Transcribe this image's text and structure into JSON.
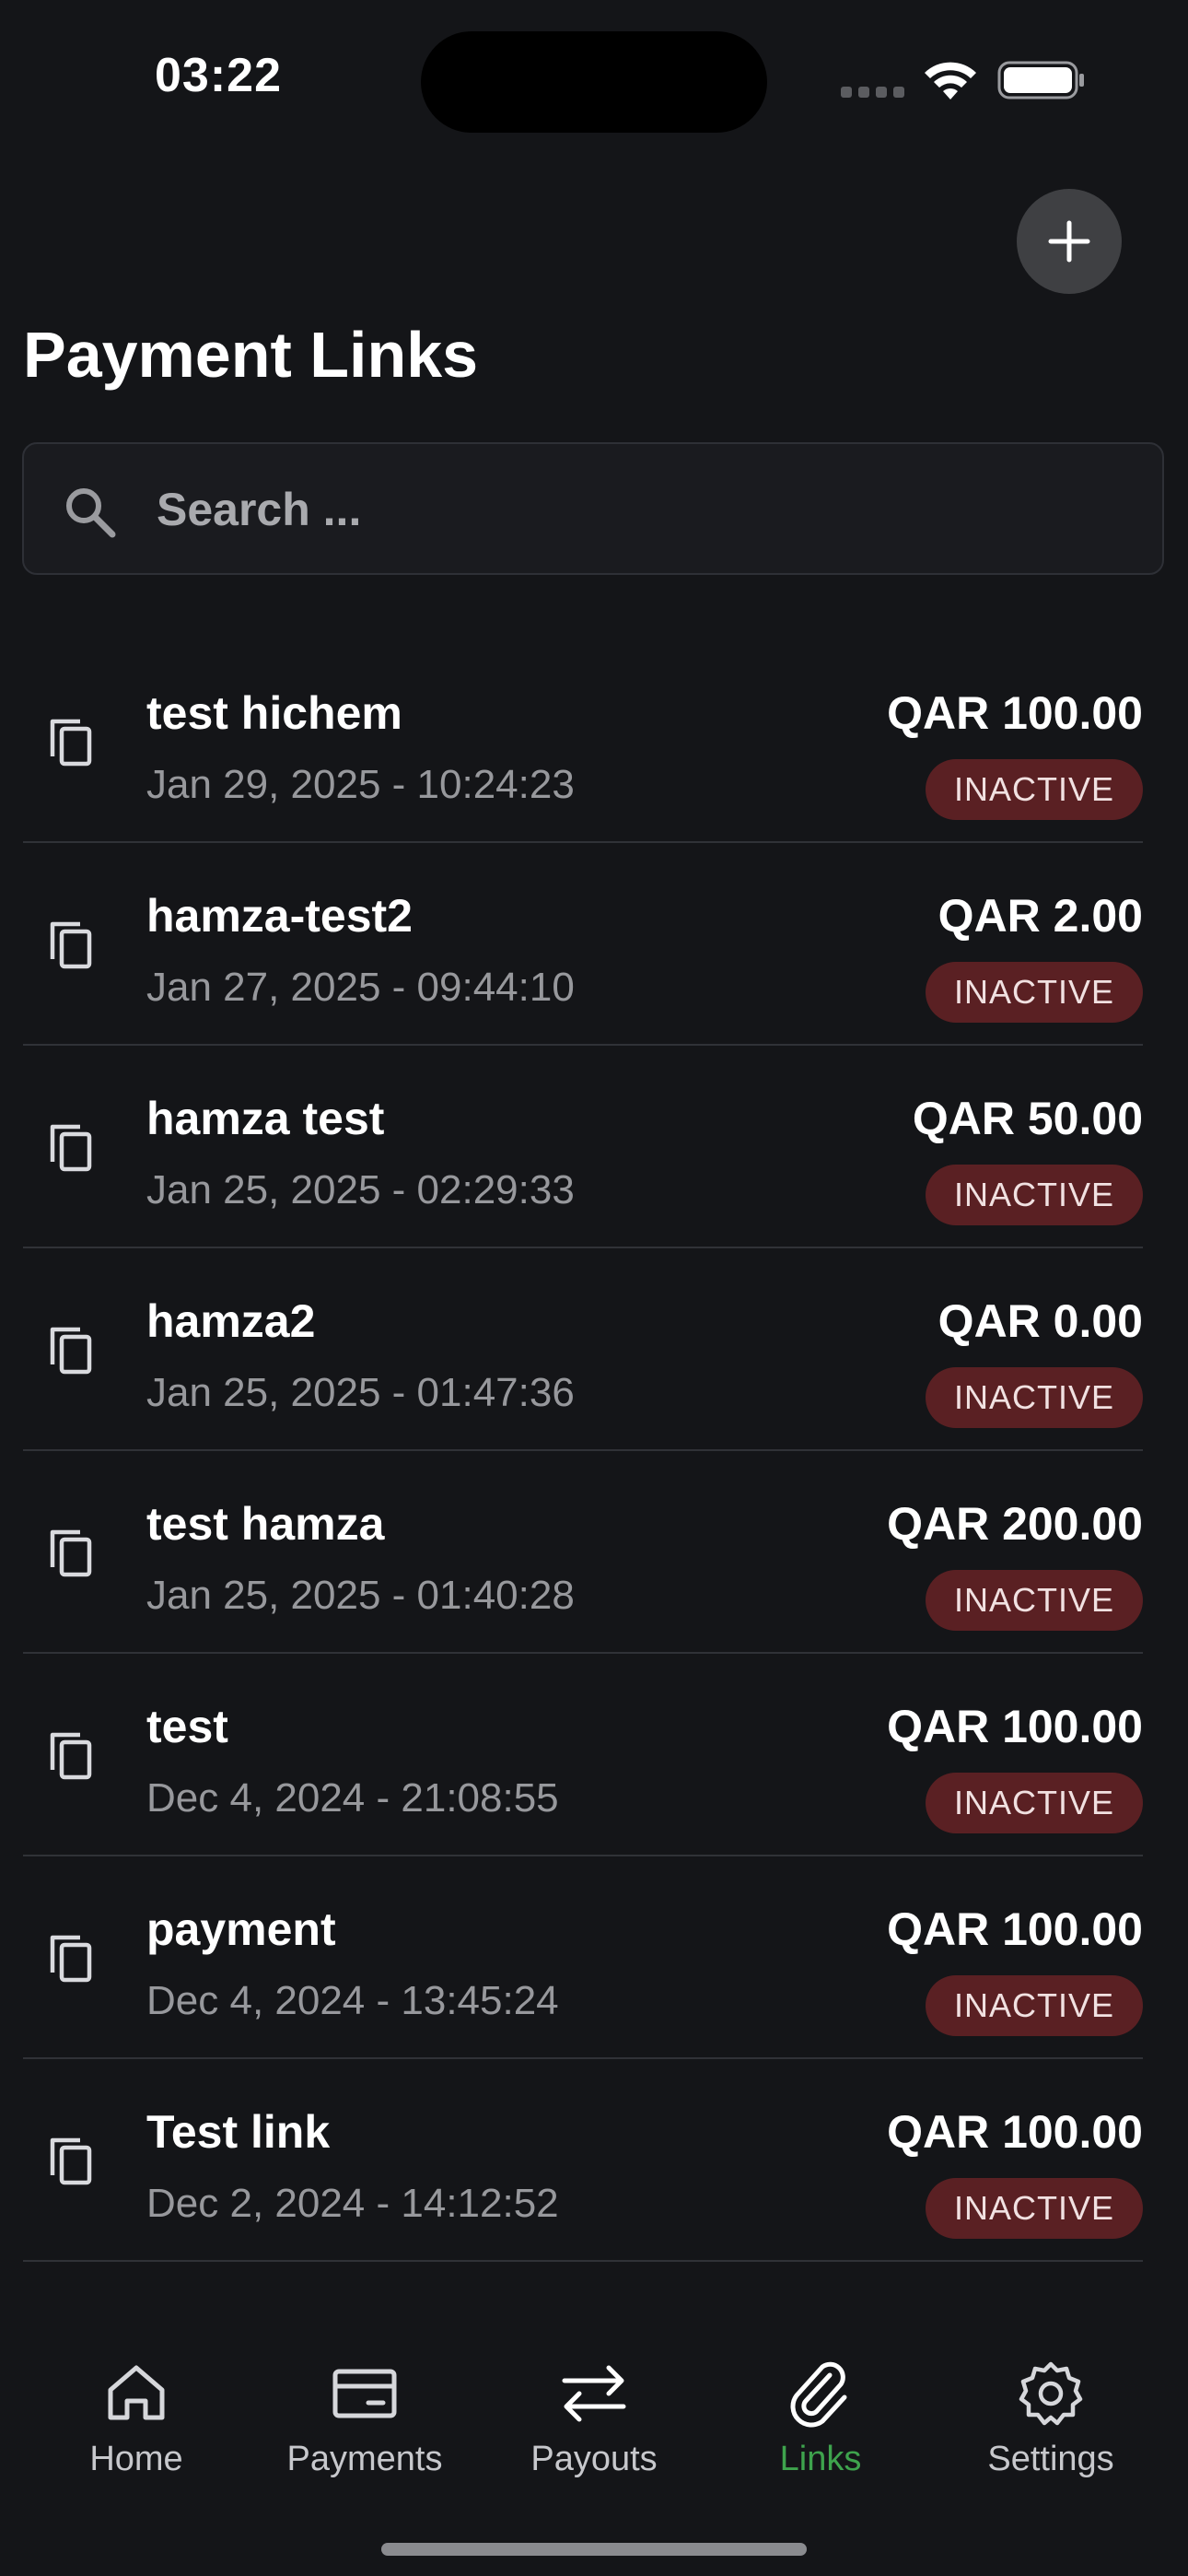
{
  "status_bar": {
    "time": "03:22",
    "icons": [
      "signal-icon",
      "wifi-icon",
      "battery-icon"
    ]
  },
  "header": {
    "title": "Payment Links",
    "add_icon": "plus-icon"
  },
  "search": {
    "placeholder": "Search ...",
    "value": ""
  },
  "links": [
    {
      "name": "test hichem",
      "date": "Jan 29, 2025 - 10:24:23",
      "amount": "QAR 100.00",
      "status": "INACTIVE"
    },
    {
      "name": "hamza-test2",
      "date": "Jan 27, 2025 - 09:44:10",
      "amount": "QAR 2.00",
      "status": "INACTIVE"
    },
    {
      "name": "hamza test",
      "date": "Jan 25, 2025 - 02:29:33",
      "amount": "QAR 50.00",
      "status": "INACTIVE"
    },
    {
      "name": "hamza2",
      "date": "Jan 25, 2025 - 01:47:36",
      "amount": "QAR 0.00",
      "status": "INACTIVE"
    },
    {
      "name": "test hamza",
      "date": "Jan 25, 2025 - 01:40:28",
      "amount": "QAR 200.00",
      "status": "INACTIVE"
    },
    {
      "name": "test",
      "date": "Dec 4, 2024 - 21:08:55",
      "amount": "QAR 100.00",
      "status": "INACTIVE"
    },
    {
      "name": "payment",
      "date": "Dec 4, 2024 - 13:45:24",
      "amount": "QAR 100.00",
      "status": "INACTIVE"
    },
    {
      "name": "Test link",
      "date": "Dec 2, 2024 - 14:12:52",
      "amount": "QAR 100.00",
      "status": "INACTIVE"
    }
  ],
  "tabs": [
    {
      "label": "Home",
      "icon": "home-icon"
    },
    {
      "label": "Payments",
      "icon": "card-icon"
    },
    {
      "label": "Payouts",
      "icon": "transfer-icon"
    },
    {
      "label": "Links",
      "icon": "paperclip-icon"
    },
    {
      "label": "Settings",
      "icon": "gear-icon"
    }
  ],
  "active_tab": "Links",
  "colors": {
    "background": "#141518",
    "badge_inactive": "#5a2023",
    "active_tab": "#3ea34d",
    "muted_text": "#97989c"
  }
}
